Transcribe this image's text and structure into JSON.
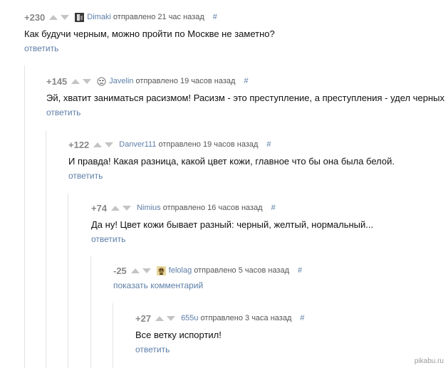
{
  "comments": [
    {
      "rating": "+230",
      "username": "Dimaki",
      "meta": "отправлено 21 час назад",
      "hash": "#",
      "text": "Как будучи черным, можно пройти по Москве не заметно?",
      "action": "ответить"
    },
    {
      "rating": "+145",
      "username": "Javelin",
      "meta": "отправлено 19 часов назад",
      "hash": "#",
      "text": "Эй, хватит заниматься расизмом! Расизм - это преступление, а преступления - удел черных",
      "action": "ответить"
    },
    {
      "rating": "+122",
      "username": "Danver111",
      "meta": "отправлено 19 часов назад",
      "hash": "#",
      "text": "И правда! Какая разница, какой цвет кожи, главное что бы она была белой.",
      "action": "ответить"
    },
    {
      "rating": "+74",
      "username": "Nimius",
      "meta": "отправлено 16 часов назад",
      "hash": "#",
      "text": "Да ну! Цвет кожи бывает разный: черный, желтый, нормальный...",
      "action": "ответить"
    },
    {
      "rating": "-25",
      "username": "felolag",
      "meta": "отправлено 5 часов назад",
      "hash": "#",
      "action": "показать комментарий"
    },
    {
      "rating": "+27",
      "username": "655u",
      "meta": "отправлено 3 часа назад",
      "hash": "#",
      "text": "Все ветку испортил!",
      "action": "ответить"
    }
  ],
  "watermark": "pikabu.ru",
  "colors": {
    "link": "#5c7ea8",
    "rating": "#888888",
    "vote_arrow": "#c4c4c4",
    "thread_line": "#e3e3e3"
  }
}
